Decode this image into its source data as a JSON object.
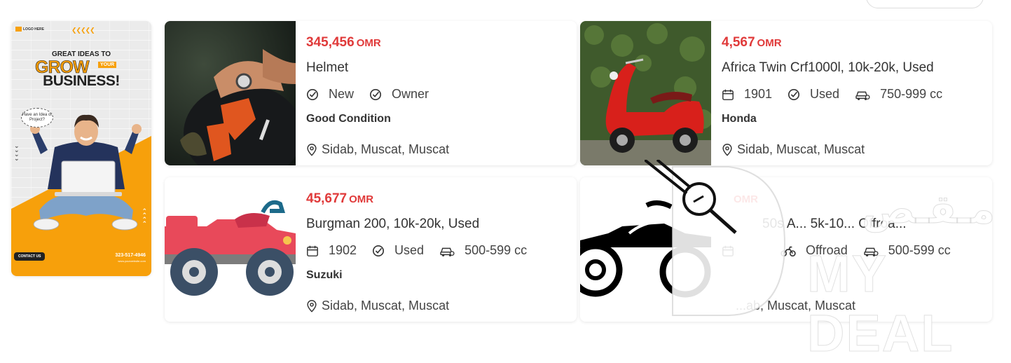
{
  "ad": {
    "logo_text": "LOGO HERE",
    "headline_1": "GREAT IDEAS TO",
    "headline_2": "GROW",
    "headline_your": "YOUR",
    "headline_3": "BUSINESS!",
    "bubble": "Have an Idea or Project?",
    "contact_button": "CONTACT US",
    "phone": "323-517-4946",
    "website": "www.yourwebsite.com",
    "accent_color": "#f7a00b"
  },
  "listings": [
    {
      "price": "345,456",
      "currency": "OMR",
      "title": "Helmet",
      "specs": [
        {
          "icon": "check-circle-icon",
          "text": "New"
        },
        {
          "icon": "check-circle-icon",
          "text": "Owner"
        }
      ],
      "brand": "Good Condition",
      "location": "Sidab, Muscat, Muscat",
      "image": "helmet-photo"
    },
    {
      "price": "4,567",
      "currency": "OMR",
      "title": "Africa Twin Crf1000l, 10k-20k, Used",
      "specs": [
        {
          "icon": "calendar-icon",
          "text": "1901"
        },
        {
          "icon": "check-circle-icon",
          "text": "Used"
        },
        {
          "icon": "car-engine-icon",
          "text": "750-999 cc"
        }
      ],
      "brand": "Honda",
      "location": "Sidab, Muscat, Muscat",
      "image": "red-scooter-photo"
    },
    {
      "price": "45,677",
      "currency": "OMR",
      "title": "Burgman 200, 10k-20k, Used",
      "specs": [
        {
          "icon": "calendar-icon",
          "text": "1902"
        },
        {
          "icon": "check-circle-icon",
          "text": "Used"
        },
        {
          "icon": "car-engine-icon",
          "text": "500-599 cc"
        }
      ],
      "brand": "Suzuki",
      "location": "Sidab, Muscat, Muscat",
      "image": "red-atv-illustration"
    },
    {
      "price": "",
      "currency": "OMR",
      "title": "50s A... 5k-10... Offroa...",
      "specs": [
        {
          "icon": "calendar-icon",
          "text": ""
        },
        {
          "icon": "motorbike-icon",
          "text": "Offroad"
        },
        {
          "icon": "car-engine-icon",
          "text": "500-599 cc"
        }
      ],
      "brand": "",
      "location": "...ab, Muscat, Muscat",
      "image": "black-atv-icon"
    }
  ],
  "watermark": {
    "arabic": "مـقـص",
    "english": "MY DEAL"
  },
  "colors": {
    "price": "#e03a3a",
    "text": "#333333"
  }
}
